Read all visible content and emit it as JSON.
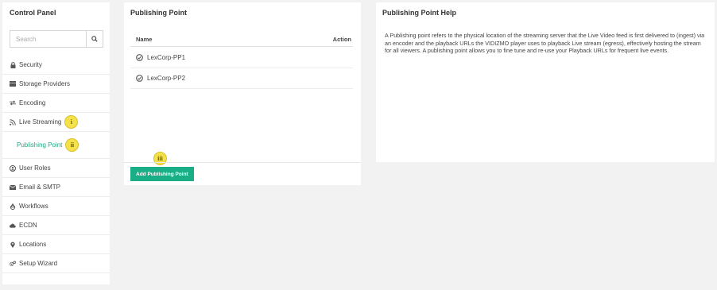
{
  "sidebar": {
    "title": "Control Panel",
    "search_placeholder": "Search",
    "items": [
      {
        "label": "Security",
        "icon": "lock-icon"
      },
      {
        "label": "Storage Providers",
        "icon": "database-icon"
      },
      {
        "label": "Encoding",
        "icon": "exchange-icon"
      },
      {
        "label": "Live Streaming",
        "icon": "rss-icon",
        "badge": "i"
      },
      {
        "label": "Publishing Point",
        "badge": "ii",
        "active": true
      },
      {
        "label": "User Roles",
        "icon": "user-circle-icon"
      },
      {
        "label": "Email & SMTP",
        "icon": "envelope-icon"
      },
      {
        "label": "Workflows",
        "icon": "recycle-icon"
      },
      {
        "label": "ECDN",
        "icon": "cloud-icon"
      },
      {
        "label": "Locations",
        "icon": "map-pin-icon"
      },
      {
        "label": "Setup Wizard",
        "icon": "cogs-icon"
      }
    ]
  },
  "publishing": {
    "title": "Publishing Point",
    "col_name": "Name",
    "col_action": "Action",
    "rows": [
      "LexCorp-PP1",
      "LexCorp-PP2"
    ],
    "add_button": "Add Publishing Point",
    "badge": "iii"
  },
  "help": {
    "title": "Publishing Point Help",
    "text": "A Publishing point refers to the physical location of the streaming server that the Live Video feed is first delivered to (ingest) via an encoder and the playback URLs the VIDIZMO player uses to playback Live stream (egress), effectively hosting the stream for all viewers. A publishing point allows you to fine tune and re-use your Playback URLs for frequent live events."
  },
  "colors": {
    "accent": "#1aae86",
    "badge": "#f5e24a"
  }
}
